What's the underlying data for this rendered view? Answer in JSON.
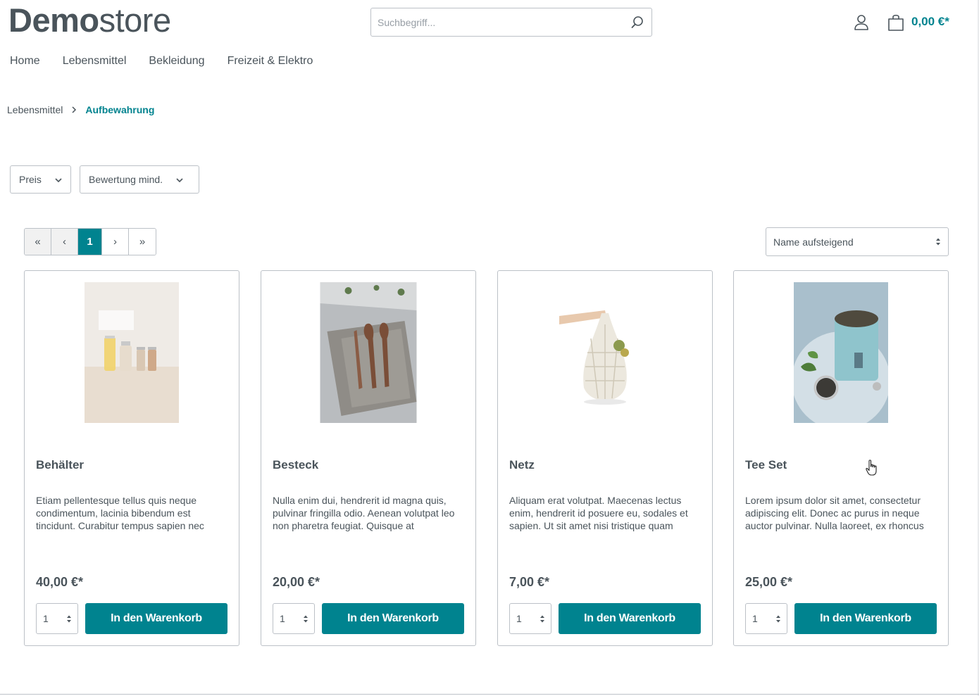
{
  "header": {
    "logo_bold": "Demo",
    "logo_light": "store",
    "search_placeholder": "Suchbegriff...",
    "cart_total": "0,00 €*",
    "icons": [
      "search-icon",
      "account-icon",
      "cart-icon"
    ]
  },
  "nav": {
    "items": [
      {
        "label": "Home"
      },
      {
        "label": "Lebensmittel"
      },
      {
        "label": "Bekleidung"
      },
      {
        "label": "Freizeit & Elektro"
      }
    ]
  },
  "breadcrumb": {
    "parent": "Lebensmittel",
    "current": "Aufbewahrung"
  },
  "filters": {
    "price": "Preis",
    "rating": "Bewertung mind."
  },
  "pagination": {
    "first": "«",
    "prev": "‹",
    "current": "1",
    "next": "›",
    "last": "»"
  },
  "sort": {
    "selected": "Name aufsteigend"
  },
  "products": [
    {
      "name": "Behälter",
      "description": "Etiam pellentesque tellus quis neque condimentum, lacinia bibendum est tincidunt. Curabitur tempus sapien nec",
      "price": "40,00 €*",
      "qty": "1",
      "button": "In den Warenkorb"
    },
    {
      "name": "Besteck",
      "description": "Nulla enim dui, hendrerit id magna quis, pulvinar fringilla odio. Aenean volutpat leo non pharetra feugiat. Quisque at",
      "price": "20,00 €*",
      "qty": "1",
      "button": "In den Warenkorb"
    },
    {
      "name": "Netz",
      "description": "Aliquam erat volutpat. Maecenas lectus enim, hendrerit id posuere eu, sodales et sapien. Ut sit amet nisi tristique quam",
      "price": "7,00 €*",
      "qty": "1",
      "button": "In den Warenkorb"
    },
    {
      "name": "Tee Set",
      "description": "Lorem ipsum dolor sit amet, consectetur adipiscing elit. Donec ac purus in neque auctor pulvinar. Nulla laoreet, ex rhoncus",
      "price": "25,00 €*",
      "qty": "1",
      "button": "In den Warenkorb"
    }
  ],
  "colors": {
    "accent": "#00838f",
    "text": "#4a545b",
    "border": "#bcc1c7"
  }
}
